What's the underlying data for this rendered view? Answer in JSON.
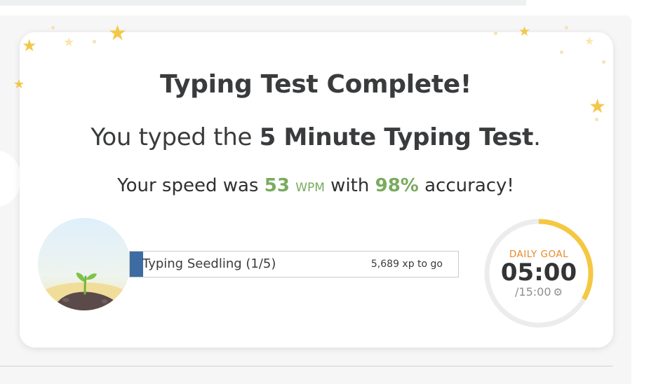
{
  "result": {
    "title": "Typing Test Complete!",
    "subtitle_prefix": "You typed the ",
    "test_name": "5 Minute Typing Test",
    "subtitle_suffix": ".",
    "speed_prefix": "Your speed was ",
    "wpm_value": "53",
    "wpm_unit": "WPM",
    "accuracy_prefix": " with ",
    "accuracy_value": "98%",
    "accuracy_suffix": " accuracy!"
  },
  "level": {
    "name": "Typing Seedling (1/5)",
    "xp_to_go": "5,689 xp to go",
    "progress": 0.04
  },
  "daily_goal": {
    "label": "DAILY GOAL",
    "time": "05:00",
    "total": "/15:00",
    "progress": 0.333
  },
  "colors": {
    "accent_green": "#7aab5e",
    "progress_blue": "#3d6ca3",
    "goal_orange": "#e58a2b",
    "goal_ring": "#f5c842",
    "star": "#f3c84a"
  },
  "icons": {
    "goal_settings": "gear-icon",
    "decoration": "star-icon",
    "avatar": "seedling-icon"
  }
}
